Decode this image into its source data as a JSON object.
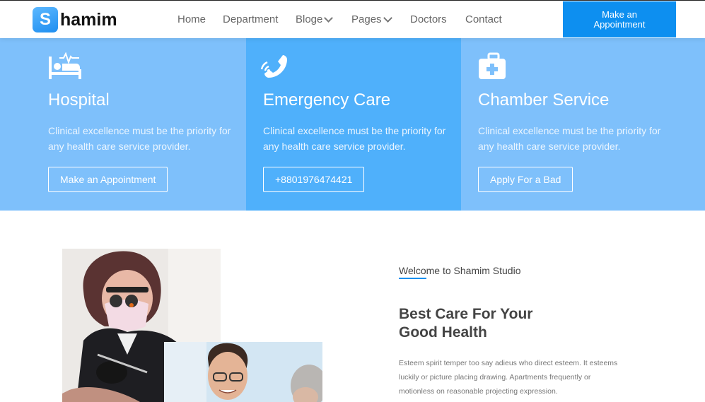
{
  "header": {
    "logo_letter": "S",
    "logo_text": "hamim",
    "nav": [
      {
        "label": "Home",
        "has_dropdown": false
      },
      {
        "label": "Department",
        "has_dropdown": false
      },
      {
        "label": "Bloge",
        "has_dropdown": true
      },
      {
        "label": "Pages",
        "has_dropdown": true
      },
      {
        "label": "Doctors",
        "has_dropdown": false
      },
      {
        "label": "Contact",
        "has_dropdown": false
      }
    ],
    "cta_label": "Make an Appointment",
    "accent_color": "#0d8ff0"
  },
  "services": [
    {
      "icon": "hospital-bed-icon",
      "title": "Hospital",
      "description": "Clinical excellence must be the priority for any health care service provider.",
      "button": "Make an Appointment",
      "bg": "#7ec0fb"
    },
    {
      "icon": "phone-ringing-icon",
      "title": "Emergency Care",
      "description": "Clinical excellence must be the priority for any health care service provider.",
      "button": "+8801976474421",
      "bg": "#4fb0fb"
    },
    {
      "icon": "first-aid-kit-icon",
      "title": "Chamber Service",
      "description": "Clinical excellence must be the priority for any health care service provider.",
      "button": "Apply For a Bad",
      "bg": "#7ec0fb"
    }
  ],
  "about": {
    "welcome": "Welcome to Shamim Studio",
    "heading_line1": "Best Care For Your",
    "heading_line2": "Good Health",
    "body": "Esteem spirit temper too say adieus who direct esteem. It esteems luckily or picture placing drawing. Apartments frequently or motionless on reasonable projecting expression."
  }
}
